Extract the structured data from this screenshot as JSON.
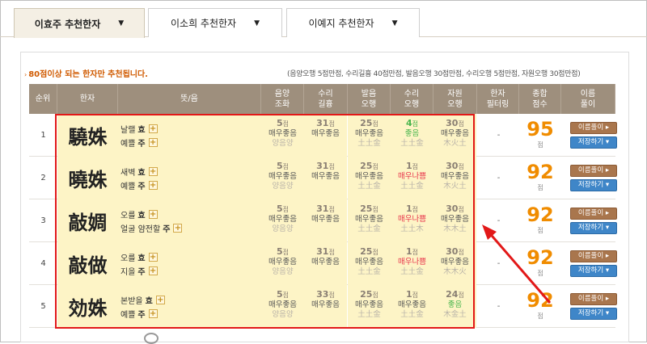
{
  "tabs": [
    {
      "label": "이효주 추천한자",
      "active": true
    },
    {
      "label": "이소희 추천한자",
      "active": false
    },
    {
      "label": "이예지 추천한자",
      "active": false
    }
  ],
  "caret": "▼",
  "notice": "80점이상 되는 한자만 추천됩니다.",
  "criteria": "(음양오행 5점만점, 수리길흉 40점만점, 발음오행 30점만점, 수리오행 5점만점, 자원오행 30점만점)",
  "headers": [
    "순위",
    "한자",
    "뜻/음",
    "음양\n조화",
    "수리\n길흉",
    "발음\n오행",
    "수리\n오행",
    "자원\n오행",
    "한자\n필터링",
    "종합\n점수",
    "이름\n풀이"
  ],
  "point_unit": "점",
  "btn_name": "이름풀이",
  "btn_save": "저장하기",
  "rows": [
    {
      "rank": "1",
      "hanja": "驍姝",
      "m1": "날랠",
      "e1": "효",
      "m2": "예쁠",
      "e2": "주",
      "s1": "5",
      "s1t": "매우좋음",
      "s1s": "양음양",
      "s2": "31",
      "s2t": "매우좋음",
      "s3": "25",
      "s3t": "매우좋음",
      "s3s": "土土金",
      "s4": "4",
      "s4t": "좋음",
      "s4s": "土土金",
      "s5": "30",
      "s5t": "매우좋음",
      "s5s": "木火土",
      "filter": "-",
      "total": "95"
    },
    {
      "rank": "2",
      "hanja": "曉姝",
      "m1": "새벽",
      "e1": "효",
      "m2": "예쁠",
      "e2": "주",
      "s1": "5",
      "s1t": "매우좋음",
      "s1s": "양음양",
      "s2": "31",
      "s2t": "매우좋음",
      "s3": "25",
      "s3t": "매우좋음",
      "s3s": "土土金",
      "s4": "1",
      "s4t": "매우나쁨",
      "s4s": "土土金",
      "s5": "30",
      "s5t": "매우좋음",
      "s5s": "木火土",
      "filter": "-",
      "total": "92"
    },
    {
      "rank": "3",
      "hanja": "敲婤",
      "m1": "오를",
      "e1": "효",
      "m2": "얼굴 얌전할",
      "e2": "주",
      "s1": "5",
      "s1t": "매우좋음",
      "s1s": "양음양",
      "s2": "31",
      "s2t": "매우좋음",
      "s3": "25",
      "s3t": "매우좋음",
      "s3s": "土土金",
      "s4": "1",
      "s4t": "매우나쁨",
      "s4s": "土土木",
      "s5": "30",
      "s5t": "매우좋음",
      "s5s": "木木土",
      "filter": "-",
      "total": "92"
    },
    {
      "rank": "4",
      "hanja": "敲做",
      "m1": "오를",
      "e1": "효",
      "m2": "지을",
      "e2": "주",
      "s1": "5",
      "s1t": "매우좋음",
      "s1s": "양음양",
      "s2": "31",
      "s2t": "매우좋음",
      "s3": "25",
      "s3t": "매우좋음",
      "s3s": "土土金",
      "s4": "1",
      "s4t": "매우나쁨",
      "s4s": "土土金",
      "s5": "30",
      "s5t": "매우좋음",
      "s5s": "木木火",
      "filter": "-",
      "total": "92"
    },
    {
      "rank": "5",
      "hanja": "効姝",
      "m1": "본받을",
      "e1": "효",
      "m2": "예쁠",
      "e2": "주",
      "s1": "5",
      "s1t": "매우좋음",
      "s1s": "양음양",
      "s2": "33",
      "s2t": "매우좋음",
      "s3": "25",
      "s3t": "매우좋음",
      "s3s": "土土金",
      "s4": "1",
      "s4t": "매우좋음",
      "s4s": "土土金",
      "s5": "24",
      "s5t": "좋음",
      "s5s": "木金土",
      "filter": "-",
      "total": "92"
    }
  ],
  "colors": {
    "header_bg": "#9e8f7d",
    "highlight": "#e21818",
    "total": "#f08c00",
    "good": "#49b54d",
    "bad": "#e8334a"
  }
}
